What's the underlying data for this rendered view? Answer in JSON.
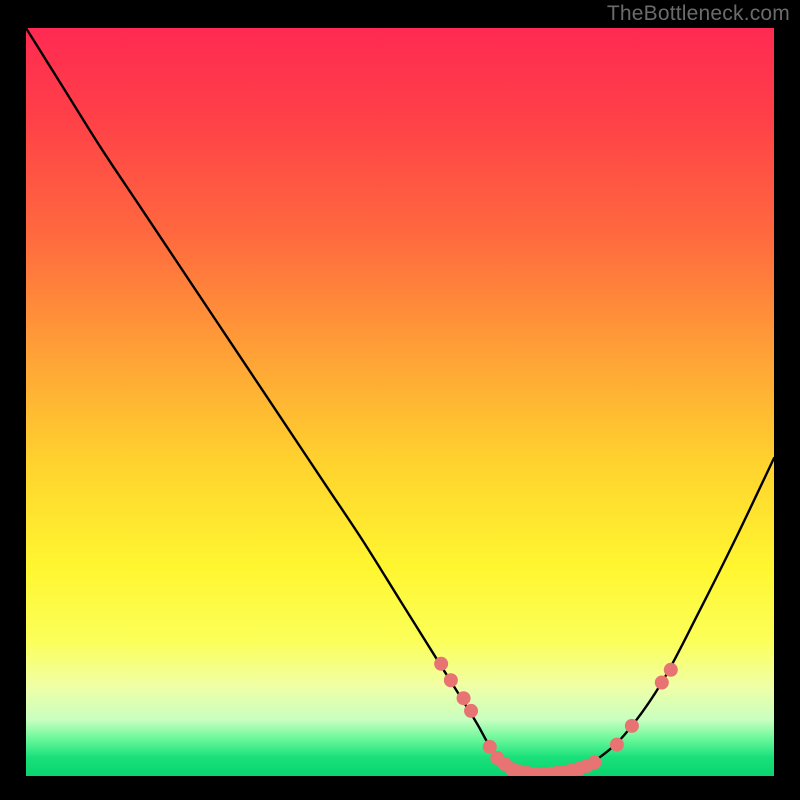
{
  "attribution": "TheBottleneck.com",
  "chart_data": {
    "type": "line",
    "title": "",
    "xlabel": "",
    "ylabel": "",
    "xlim": [
      0,
      100
    ],
    "ylim": [
      0,
      100
    ],
    "grid": false,
    "legend": false,
    "series": [
      {
        "name": "bottleneck-curve",
        "x": [
          0,
          5,
          10,
          15,
          20,
          25,
          30,
          35,
          40,
          45,
          50,
          55,
          60,
          62,
          64,
          67,
          70,
          73,
          76,
          80,
          85,
          90,
          95,
          100
        ],
        "y": [
          100,
          92,
          84,
          76.5,
          69,
          61.5,
          54,
          46.5,
          39,
          31.5,
          23.5,
          15.5,
          7.5,
          4,
          1.8,
          0.3,
          0,
          0.5,
          2,
          5.5,
          12.5,
          22,
          32,
          42.5
        ]
      }
    ],
    "markers": [
      {
        "x": 55.5,
        "y": 15.0
      },
      {
        "x": 56.8,
        "y": 12.8
      },
      {
        "x": 58.5,
        "y": 10.4
      },
      {
        "x": 59.5,
        "y": 8.7
      },
      {
        "x": 62.0,
        "y": 3.9
      },
      {
        "x": 63.0,
        "y": 2.4
      },
      {
        "x": 64.0,
        "y": 1.6
      },
      {
        "x": 65.0,
        "y": 0.9
      },
      {
        "x": 66.0,
        "y": 0.6
      },
      {
        "x": 67.0,
        "y": 0.4
      },
      {
        "x": 68.0,
        "y": 0.25
      },
      {
        "x": 69.0,
        "y": 0.2
      },
      {
        "x": 70.0,
        "y": 0.3
      },
      {
        "x": 71.0,
        "y": 0.4
      },
      {
        "x": 72.0,
        "y": 0.55
      },
      {
        "x": 73.0,
        "y": 0.75
      },
      {
        "x": 74.0,
        "y": 1.0
      },
      {
        "x": 75.0,
        "y": 1.35
      },
      {
        "x": 76.0,
        "y": 1.8
      },
      {
        "x": 79.0,
        "y": 4.2
      },
      {
        "x": 81.0,
        "y": 6.7
      },
      {
        "x": 85.0,
        "y": 12.5
      },
      {
        "x": 86.2,
        "y": 14.2
      }
    ],
    "gradient_stops": [
      {
        "pos": 0,
        "color": "#ff2a52"
      },
      {
        "pos": 0.5,
        "color": "#ffcf2e"
      },
      {
        "pos": 0.82,
        "color": "#fbff59"
      },
      {
        "pos": 0.95,
        "color": "#6cf89a"
      },
      {
        "pos": 1.0,
        "color": "#0ad46f"
      }
    ],
    "curve_color": "#000000",
    "marker_color": "#e77373",
    "marker_radius_px": 7
  }
}
